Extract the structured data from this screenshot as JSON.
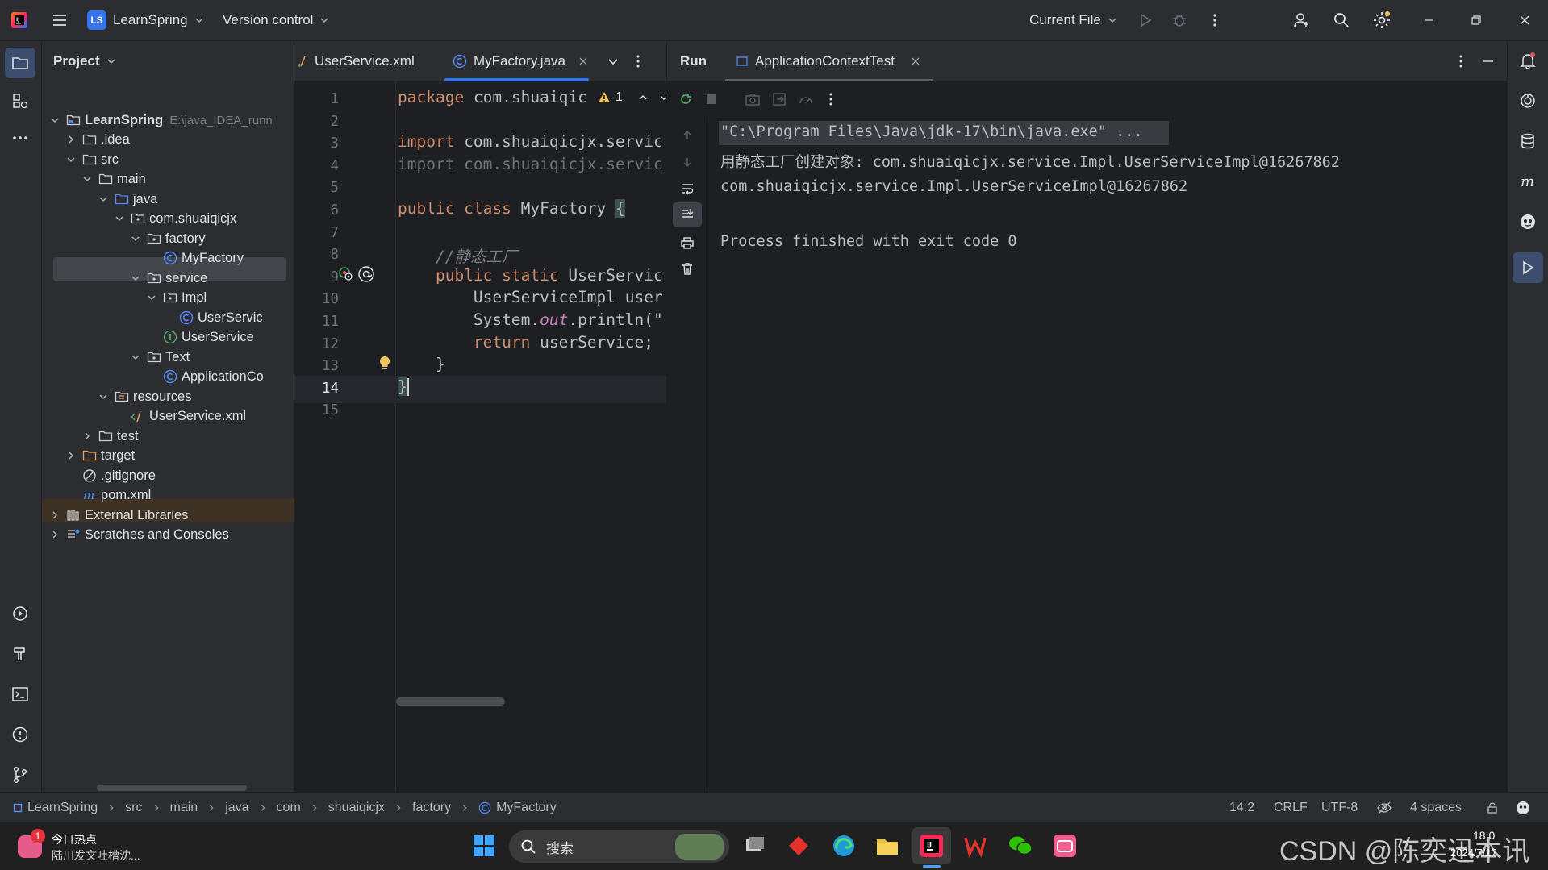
{
  "titlebar": {
    "project_badge": "LS",
    "project_name": "LearnSpring",
    "vcs": "Version control",
    "run_config": "Current File"
  },
  "project_panel": {
    "title": "Project",
    "root_path": "E:\\java_IDEA_runn",
    "items": [
      {
        "label": "LearnSpring"
      },
      {
        "label": ".idea"
      },
      {
        "label": "src"
      },
      {
        "label": "main"
      },
      {
        "label": "java"
      },
      {
        "label": "com.shuaiqicjx"
      },
      {
        "label": "factory"
      },
      {
        "label": "MyFactory"
      },
      {
        "label": "service"
      },
      {
        "label": "Impl"
      },
      {
        "label": "UserServic"
      },
      {
        "label": "UserService"
      },
      {
        "label": "Text"
      },
      {
        "label": "ApplicationCo"
      },
      {
        "label": "resources"
      },
      {
        "label": "UserService.xml"
      },
      {
        "label": "test"
      },
      {
        "label": "target"
      },
      {
        "label": ".gitignore"
      },
      {
        "label": "pom.xml"
      },
      {
        "label": "External Libraries"
      },
      {
        "label": "Scratches and Consoles"
      }
    ]
  },
  "editor": {
    "tabs": [
      {
        "label": "UserService.xml"
      },
      {
        "label": "MyFactory.java"
      }
    ],
    "warning_count": "1",
    "line_numbers": [
      "1",
      "2",
      "3",
      "4",
      "5",
      "6",
      "7",
      "8",
      "9",
      "10",
      "11",
      "12",
      "13",
      "14",
      "15"
    ],
    "code": {
      "l1_kw": "package",
      "l1_rest": " com.shuaiqic",
      "l3_kw": "import",
      "l3_rest": " com.shuaiqicjx.servic",
      "l4": "import com.shuaiqicjx.servic",
      "l6_kw": "public class",
      "l6_rest": " MyFactory ",
      "l6_brace": "{",
      "l8": "    //静态工厂",
      "l9_indent": "    ",
      "l9_kw": "public static",
      "l9_rest": " UserServic",
      "l10": "        UserServiceImpl user",
      "l11_a": "        System.",
      "l11_b": "out",
      "l11_c": ".println(\"",
      "l12_indent": "        ",
      "l12_kw": "return",
      "l12_rest": " userService;",
      "l13": "    }",
      "l14": "}"
    }
  },
  "run_panel": {
    "title": "Run",
    "tab": "ApplicationContextTest",
    "console": [
      "\"C:\\Program Files\\Java\\jdk-17\\bin\\java.exe\" ...",
      "用静态工厂创建对象: com.shuaiqicjx.service.Impl.UserServiceImpl@16267862",
      "com.shuaiqicjx.service.Impl.UserServiceImpl@16267862",
      "",
      "Process finished with exit code 0"
    ]
  },
  "statusbar": {
    "breadcrumbs": [
      "LearnSpring",
      "src",
      "main",
      "java",
      "com",
      "shuaiqicjx",
      "factory",
      "MyFactory"
    ],
    "position": "14:2",
    "line_sep": "CRLF",
    "encoding": "UTF-8",
    "indent": "4 spaces"
  },
  "taskbar": {
    "news_title": "今日热点",
    "news_sub": "陆川发文吐槽沈...",
    "news_badge": "1",
    "search_placeholder": "搜索",
    "time": "18:0",
    "date": "2024/7/17",
    "watermark": "CSDN @陈奕迅本讯"
  },
  "colors": {
    "background": "#1e1f22",
    "panel": "#2b2d30",
    "accent": "#3574f0",
    "keyword": "#cf8e6d",
    "text": "#bcbec4"
  }
}
